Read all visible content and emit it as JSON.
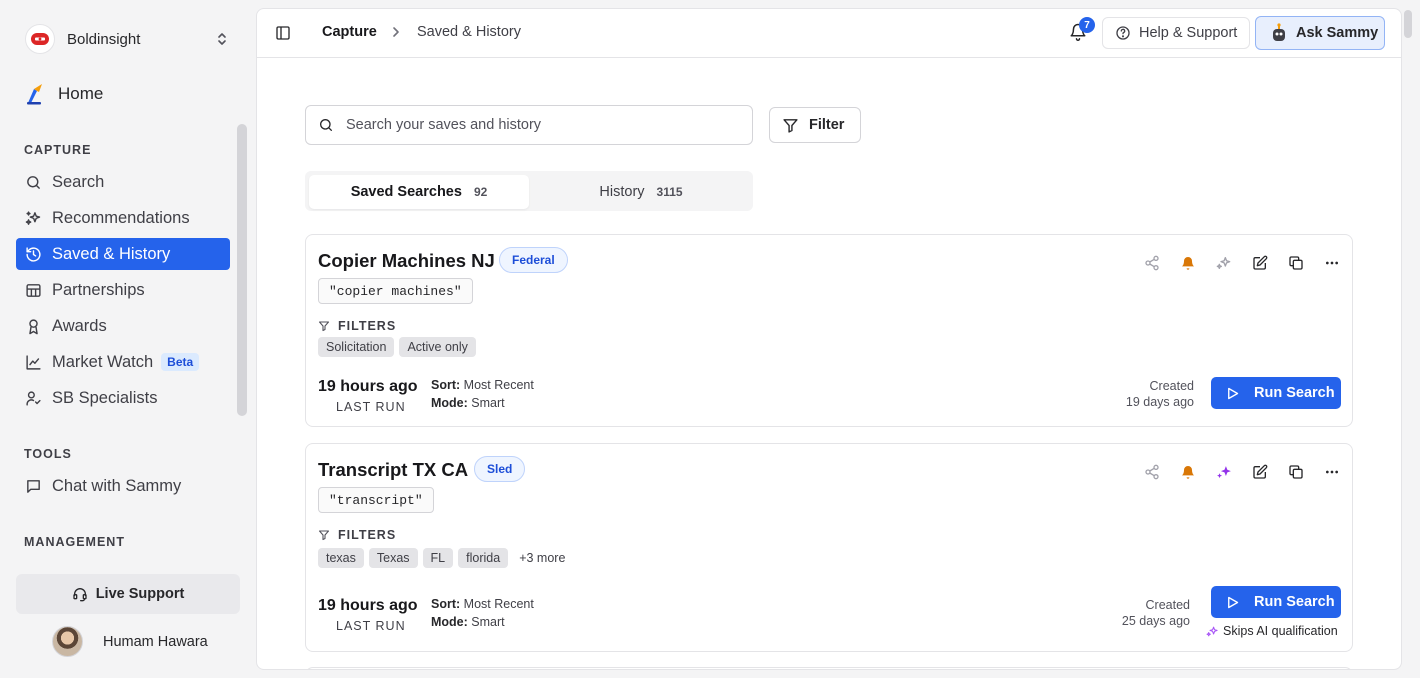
{
  "sidebar": {
    "org_name": "Boldinsight",
    "home_label": "Home",
    "sections": {
      "capture": "CAPTURE",
      "tools": "TOOLS",
      "management": "MANAGEMENT"
    },
    "capture_items": [
      {
        "label": "Search",
        "icon": "search-icon"
      },
      {
        "label": "Recommendations",
        "icon": "sparkles-icon"
      },
      {
        "label": "Saved & History",
        "icon": "history-icon",
        "active": true
      },
      {
        "label": "Partnerships",
        "icon": "handshake-icon"
      },
      {
        "label": "Awards",
        "icon": "award-icon"
      },
      {
        "label": "Market Watch",
        "icon": "line-chart-icon",
        "badge": "Beta"
      },
      {
        "label": "SB Specialists",
        "icon": "user-check-icon"
      }
    ],
    "tools_items": [
      {
        "label": "Chat with Sammy",
        "icon": "chat-icon"
      }
    ],
    "live_support": "Live Support",
    "user_name": "Humam Hawara"
  },
  "topbar": {
    "breadcrumb_root": "Capture",
    "breadcrumb_current": "Saved & History",
    "notification_count": "7",
    "help_label": "Help & Support",
    "ask_label": "Ask Sammy"
  },
  "search": {
    "placeholder": "Search your saves and history",
    "filter_label": "Filter"
  },
  "tabs": [
    {
      "label": "Saved Searches",
      "count": "92",
      "active": true
    },
    {
      "label": "History",
      "count": "3115"
    }
  ],
  "cards": [
    {
      "title": "Copier Machines NJ",
      "tag": "Federal",
      "query": "\"copier machines\"",
      "filters_label": "FILTERS",
      "chips": [
        "Solicitation",
        "Active only"
      ],
      "last_run": "19 hours ago",
      "last_run_label": "LAST RUN",
      "sort_key": "Sort:",
      "sort_value": "Most Recent",
      "mode_key": "Mode:",
      "mode_value": "Smart",
      "created_label": "Created",
      "created_value": "19 days ago",
      "run_label": "Run Search"
    },
    {
      "title": "Transcript TX CA",
      "tag": "Sled",
      "query": "\"transcript\"",
      "filters_label": "FILTERS",
      "chips": [
        "texas",
        "Texas",
        "FL",
        "florida"
      ],
      "more": "+3 more",
      "last_run": "19 hours ago",
      "last_run_label": "LAST RUN",
      "sort_key": "Sort:",
      "sort_value": "Most Recent",
      "mode_key": "Mode:",
      "mode_value": "Smart",
      "created_label": "Created",
      "created_value": "25 days ago",
      "run_label": "Run Search",
      "skips_label": "Skips AI qualification"
    }
  ],
  "colors": {
    "accent": "#2563eb",
    "bell_active": "#d97706",
    "ai_active": "#9333ea"
  }
}
